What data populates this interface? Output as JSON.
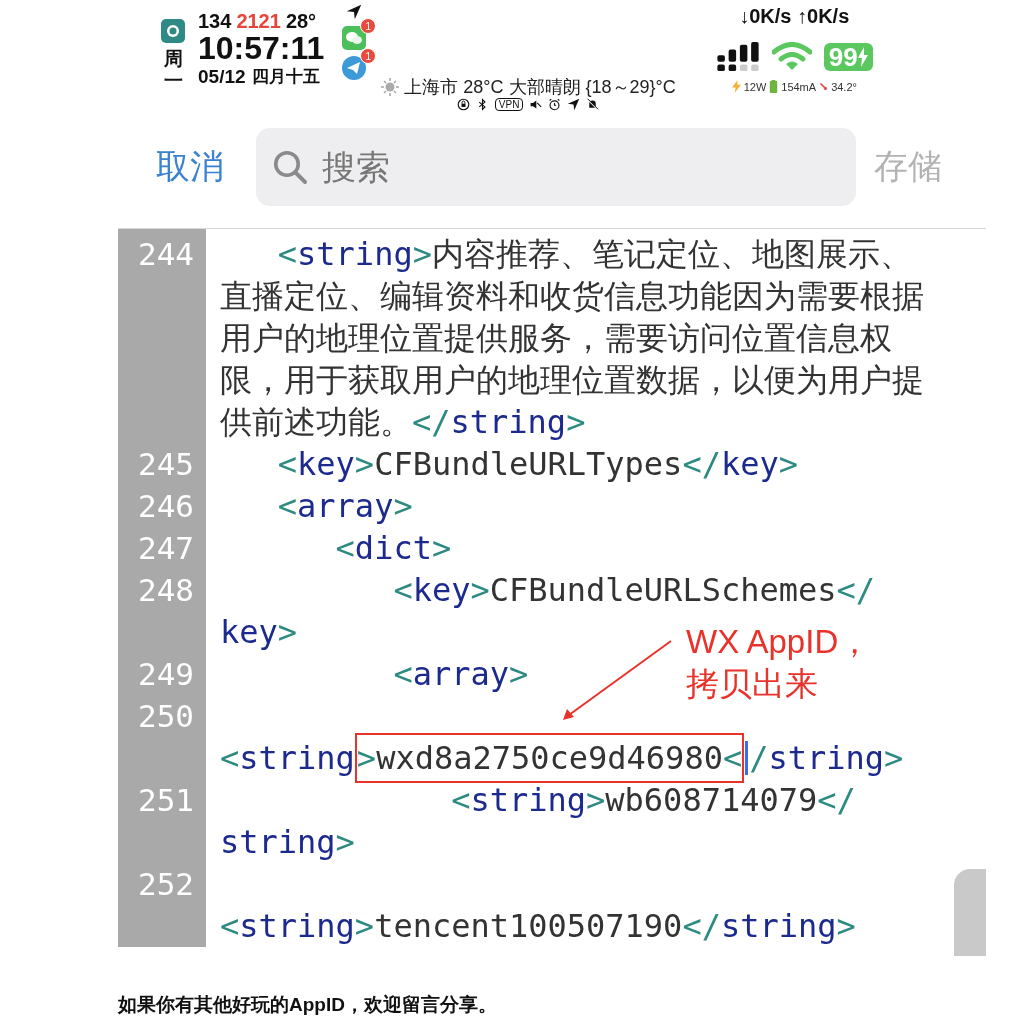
{
  "status_bar": {
    "weekday": "周一",
    "counters": [
      {
        "text": "134",
        "highlight": false
      },
      {
        "text": "2121",
        "highlight": true
      },
      {
        "text": "28°",
        "highlight": false
      }
    ],
    "time": "10:57:11",
    "date": "05/12",
    "lunar_date": "四月十五",
    "notifications": [
      {
        "kind": "chat",
        "badge": "1"
      },
      {
        "kind": "send",
        "badge": "1"
      }
    ],
    "weather": "上海市 28°C 大部晴朗 {18～29}°C",
    "vpn": "VPN",
    "network_speed": "↓0K/s ↑0K/s",
    "battery": {
      "percent": "99",
      "charging": true
    },
    "power": "12W",
    "current": "154mA",
    "temperature": "34.2°"
  },
  "search_bar": {
    "cancel": "取消",
    "placeholder": "搜索",
    "save": "存储"
  },
  "editor": {
    "lines": [
      {
        "number": "244",
        "segments": [
          {
            "kind": "punct",
            "text": "<"
          },
          {
            "kind": "tag",
            "text": "string"
          },
          {
            "kind": "punct",
            "text": ">"
          },
          {
            "kind": "text",
            "text": "内容推荐、笔记定位、地图展示、"
          }
        ]
      },
      {
        "segments": [
          {
            "kind": "text",
            "text": "直播定位、编辑资料和收货信息功能因为需要根据"
          }
        ]
      },
      {
        "segments": [
          {
            "kind": "text",
            "text": "用户的地理位置提供服务，需要访问位置信息权"
          }
        ]
      },
      {
        "segments": [
          {
            "kind": "text",
            "text": "限，用于获取用户的地理位置数据，以便为用户提"
          }
        ]
      },
      {
        "segments": [
          {
            "kind": "text",
            "text": "供前述功能。"
          },
          {
            "kind": "punct",
            "text": "</"
          },
          {
            "kind": "tag",
            "text": "string"
          },
          {
            "kind": "punct",
            "text": ">"
          }
        ]
      },
      {
        "number": "245",
        "segments": [
          {
            "kind": "punct",
            "text": "<"
          },
          {
            "kind": "tag",
            "text": "key"
          },
          {
            "kind": "punct",
            "text": ">"
          },
          {
            "kind": "text",
            "text": "CFBundleURLTypes"
          },
          {
            "kind": "punct",
            "text": "</"
          },
          {
            "kind": "tag",
            "text": "key"
          },
          {
            "kind": "punct",
            "text": ">"
          }
        ]
      },
      {
        "number": "246",
        "segments": [
          {
            "kind": "punct",
            "text": "<"
          },
          {
            "kind": "tag",
            "text": "array"
          },
          {
            "kind": "punct",
            "text": ">"
          }
        ]
      },
      {
        "number": "247",
        "segments": [
          {
            "kind": "punct",
            "text": "<"
          },
          {
            "kind": "tag",
            "text": "dict"
          },
          {
            "kind": "punct",
            "text": ">"
          }
        ]
      },
      {
        "number": "248",
        "segments": [
          {
            "kind": "punct",
            "text": "<"
          },
          {
            "kind": "tag",
            "text": "key"
          },
          {
            "kind": "punct",
            "text": ">"
          },
          {
            "kind": "text",
            "text": "CFBundleURLSchemes"
          },
          {
            "kind": "punct",
            "text": "</"
          }
        ]
      },
      {
        "segments": [
          {
            "kind": "tag",
            "text": "key"
          },
          {
            "kind": "punct",
            "text": ">"
          }
        ]
      },
      {
        "number": "249",
        "segments": [
          {
            "kind": "punct",
            "text": "<"
          },
          {
            "kind": "tag",
            "text": "array"
          },
          {
            "kind": "punct",
            "text": ">"
          }
        ]
      },
      {
        "number": "250"
      },
      {
        "segments": [
          {
            "kind": "punct",
            "text": "<"
          },
          {
            "kind": "tag",
            "text": "string"
          },
          {
            "kind": "punct",
            "text": ">",
            "boxed": true
          },
          {
            "kind": "text",
            "text": "wxd8a2750ce9d46980",
            "boxed": true
          },
          {
            "kind": "punct",
            "text": "<",
            "boxed": true
          },
          {
            "kind": "punct",
            "text": "/"
          },
          {
            "kind": "tag",
            "text": "string"
          },
          {
            "kind": "punct",
            "text": ">"
          }
        ]
      },
      {
        "number": "251",
        "segments": [
          {
            "kind": "punct",
            "text": "<"
          },
          {
            "kind": "tag",
            "text": "string"
          },
          {
            "kind": "punct",
            "text": ">"
          },
          {
            "kind": "text",
            "text": "wb608714079"
          },
          {
            "kind": "punct",
            "text": "</"
          }
        ]
      },
      {
        "segments": [
          {
            "kind": "tag",
            "text": "string"
          },
          {
            "kind": "punct",
            "text": ">"
          }
        ]
      },
      {
        "number": "252"
      },
      {
        "segments": [
          {
            "kind": "punct",
            "text": "<"
          },
          {
            "kind": "tag",
            "text": "string"
          },
          {
            "kind": "punct",
            "text": ">"
          },
          {
            "kind": "text",
            "text": "tencent100507190"
          },
          {
            "kind": "punct",
            "text": "</"
          },
          {
            "kind": "tag",
            "text": "string"
          },
          {
            "kind": "punct",
            "text": ">"
          }
        ]
      }
    ]
  },
  "annotation": {
    "lines": [
      "WX AppID，",
      "拷贝出来"
    ]
  },
  "caption": "如果你有其他好玩的AppID，欢迎留言分享。"
}
